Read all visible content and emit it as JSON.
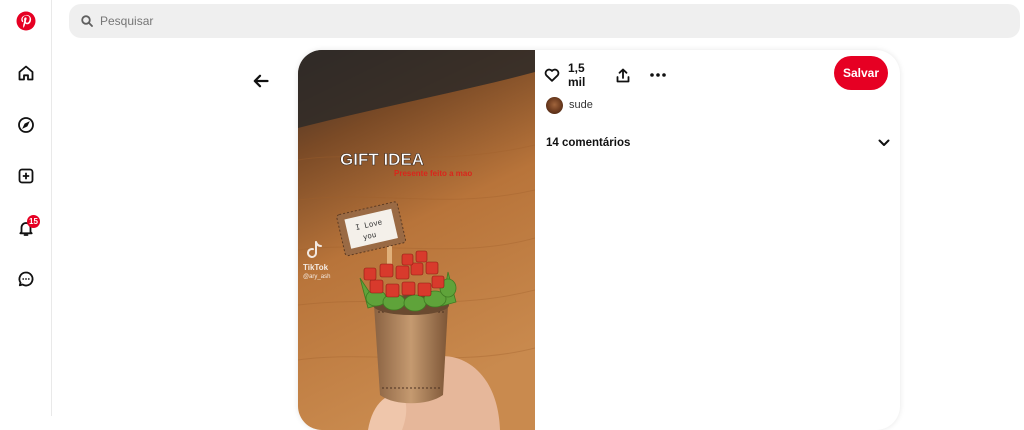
{
  "brand": {
    "logo_icon": "pinterest-logo-icon",
    "color": "#e60023"
  },
  "sidebar": {
    "items": [
      {
        "name": "home",
        "icon": "home-icon"
      },
      {
        "name": "explore",
        "icon": "compass-icon"
      },
      {
        "name": "create",
        "icon": "plus-square-icon"
      },
      {
        "name": "notifications",
        "icon": "bell-icon",
        "badge": "15"
      },
      {
        "name": "messages",
        "icon": "chat-icon"
      }
    ]
  },
  "search": {
    "placeholder": "Pesquisar",
    "icon": "search-icon"
  },
  "pin": {
    "overlay_title": "GIFT IDEA",
    "overlay_subtitle": "Presente feito a mao",
    "sign_text_line1": "I Love",
    "sign_text_line2": "you",
    "watermark_brand": "TikTok",
    "watermark_user": "@ary_ash"
  },
  "actions": {
    "reaction_count": "1,5 mil",
    "save_label": "Salvar"
  },
  "author": {
    "name": "sude"
  },
  "comments": {
    "label": "14 comentários"
  }
}
